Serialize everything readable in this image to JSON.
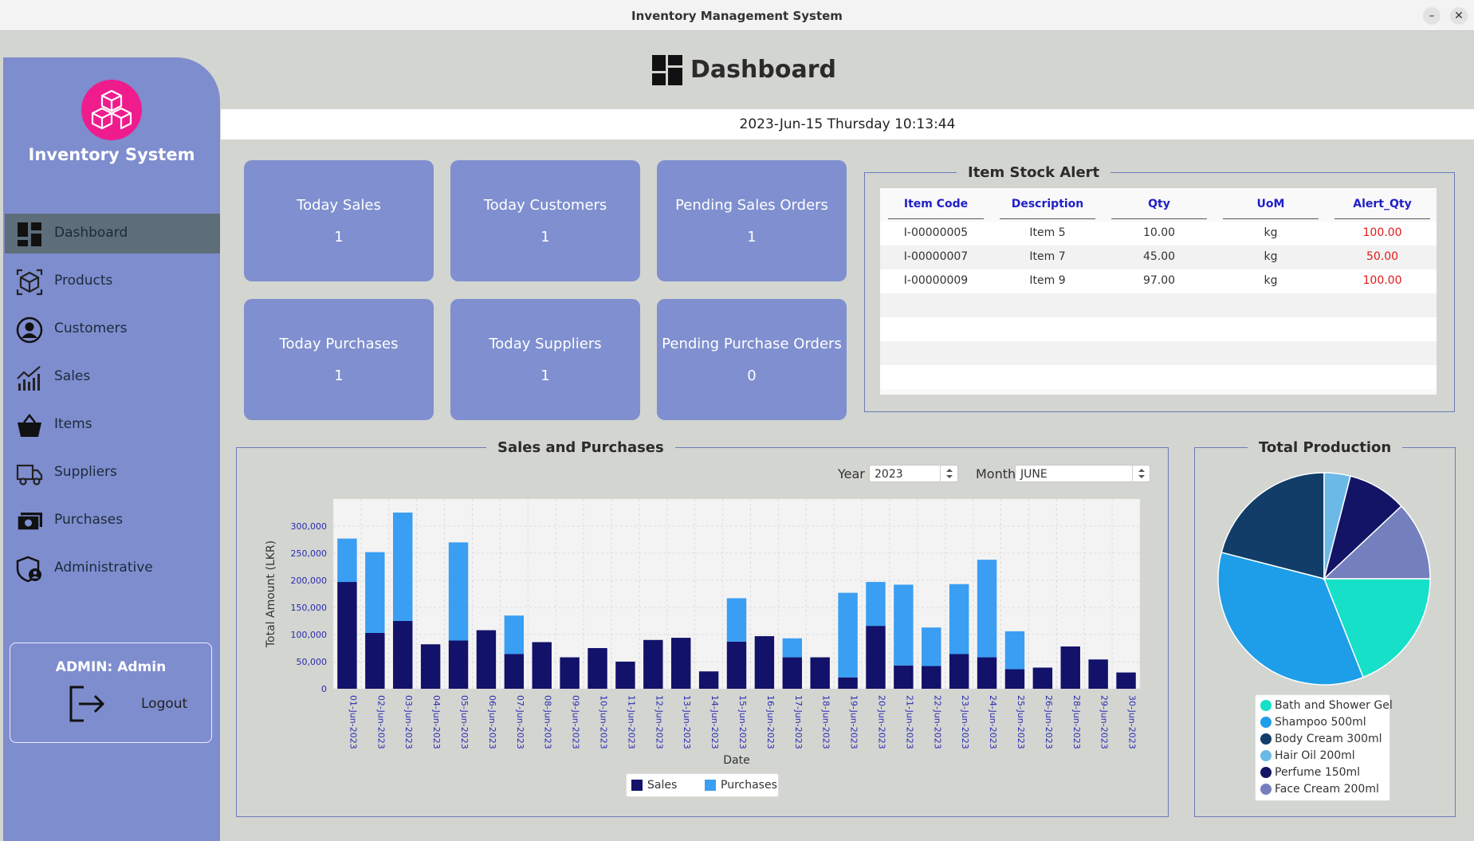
{
  "window": {
    "title": "Inventory Management System",
    "minimize": "–",
    "close": "✕"
  },
  "sidebar": {
    "brand": "Inventory System",
    "items": [
      {
        "label": "Dashboard",
        "icon": "dashboard-icon",
        "active": true
      },
      {
        "label": "Products",
        "icon": "cube-icon"
      },
      {
        "label": "Customers",
        "icon": "user-circle-icon"
      },
      {
        "label": "Sales",
        "icon": "chart-line-icon"
      },
      {
        "label": "Items",
        "icon": "basket-icon"
      },
      {
        "label": "Suppliers",
        "icon": "truck-icon"
      },
      {
        "label": "Purchases",
        "icon": "money-icon"
      },
      {
        "label": "Administrative",
        "icon": "shield-user-icon"
      }
    ],
    "admin_label": "ADMIN: Admin",
    "logout_label": "Logout"
  },
  "header": {
    "title": "Dashboard",
    "datetime": "2023-Jun-15 Thursday 10:13:44"
  },
  "cards": [
    {
      "title": "Today Sales",
      "value": "1"
    },
    {
      "title": "Today Customers",
      "value": "1"
    },
    {
      "title": "Pending Sales Orders",
      "value": "1"
    },
    {
      "title": "Today Purchases",
      "value": "1"
    },
    {
      "title": "Today Suppliers",
      "value": "1"
    },
    {
      "title": "Pending Purchase Orders",
      "value": "0"
    }
  ],
  "stock_alert": {
    "title": "Item Stock Alert",
    "columns": [
      "Item Code",
      "Description",
      "Qty",
      "UoM",
      "Alert_Qty"
    ],
    "rows": [
      [
        "I-00000005",
        "Item 5",
        "10.00",
        "kg",
        "100.00"
      ],
      [
        "I-00000007",
        "Item 7",
        "45.00",
        "kg",
        "50.00"
      ],
      [
        "I-00000009",
        "Item 9",
        "97.00",
        "kg",
        "100.00"
      ]
    ]
  },
  "sales_panel": {
    "title": "Sales and Purchases",
    "year_label": "Year",
    "year_value": "2023",
    "month_label": "Month",
    "month_value": "JUNE"
  },
  "production_panel": {
    "title": "Total Production"
  },
  "colors": {
    "sales": "#12126a",
    "purchases": "#3a9ef3",
    "sidebar": "#7e8dce",
    "card": "#7f8fcf",
    "alert": "#e0191b"
  },
  "chart_data": [
    {
      "type": "bar",
      "stacked": true,
      "xlabel": "Date",
      "ylabel": "Total Amount (LKR)",
      "ylim": [
        0,
        350000
      ],
      "yticks": [
        0,
        50000,
        100000,
        150000,
        200000,
        250000,
        300000
      ],
      "ytick_labels": [
        "0",
        "50,000",
        "100,000",
        "150,000",
        "200,000",
        "250,000",
        "300,000"
      ],
      "grid": true,
      "legend": "bottom",
      "categories": [
        "01-Jun-2023",
        "02-Jun-2023",
        "03-Jun-2023",
        "04-Jun-2023",
        "05-Jun-2023",
        "06-Jun-2023",
        "07-Jun-2023",
        "08-Jun-2023",
        "09-Jun-2023",
        "10-Jun-2023",
        "11-Jun-2023",
        "12-Jun-2023",
        "13-Jun-2023",
        "14-Jun-2023",
        "15-Jun-2023",
        "16-Jun-2023",
        "17-Jun-2023",
        "18-Jun-2023",
        "19-Jun-2023",
        "20-Jun-2023",
        "21-Jun-2023",
        "22-Jun-2023",
        "23-Jun-2023",
        "24-Jun-2023",
        "25-Jun-2023",
        "26-Jun-2023",
        "28-Jun-2023",
        "29-Jun-2023",
        "30-Jun-2023"
      ],
      "series": [
        {
          "name": "Sales",
          "values": [
            197000,
            103000,
            125000,
            82000,
            89000,
            108000,
            64000,
            86000,
            58000,
            75000,
            50000,
            90000,
            94000,
            32000,
            87000,
            97000,
            58000,
            58000,
            21000,
            116000,
            43000,
            42000,
            64000,
            58000,
            36000,
            39000,
            78000,
            54000,
            30000
          ]
        },
        {
          "name": "Purchases",
          "values": [
            80000,
            149000,
            200000,
            0,
            181000,
            0,
            71000,
            0,
            0,
            0,
            0,
            0,
            0,
            0,
            80000,
            0,
            35000,
            0,
            156000,
            81000,
            149000,
            71000,
            129000,
            180000,
            70000,
            0,
            0,
            0,
            0
          ]
        }
      ]
    },
    {
      "type": "pie",
      "legend": "bottom",
      "slices": [
        {
          "name": "Bath and Shower Gel",
          "value": 19,
          "color": "#16e0c8"
        },
        {
          "name": "Shampoo 500ml",
          "value": 35,
          "color": "#1e9ee8"
        },
        {
          "name": "Body Cream 300ml",
          "value": 21,
          "color": "#123d68"
        },
        {
          "name": "Hair Oil 200ml",
          "value": 4,
          "color": "#6ab9e6"
        },
        {
          "name": "Perfume 150ml",
          "value": 9,
          "color": "#141466"
        },
        {
          "name": "Face Cream 200ml",
          "value": 12,
          "color": "#7480bd"
        }
      ]
    }
  ]
}
